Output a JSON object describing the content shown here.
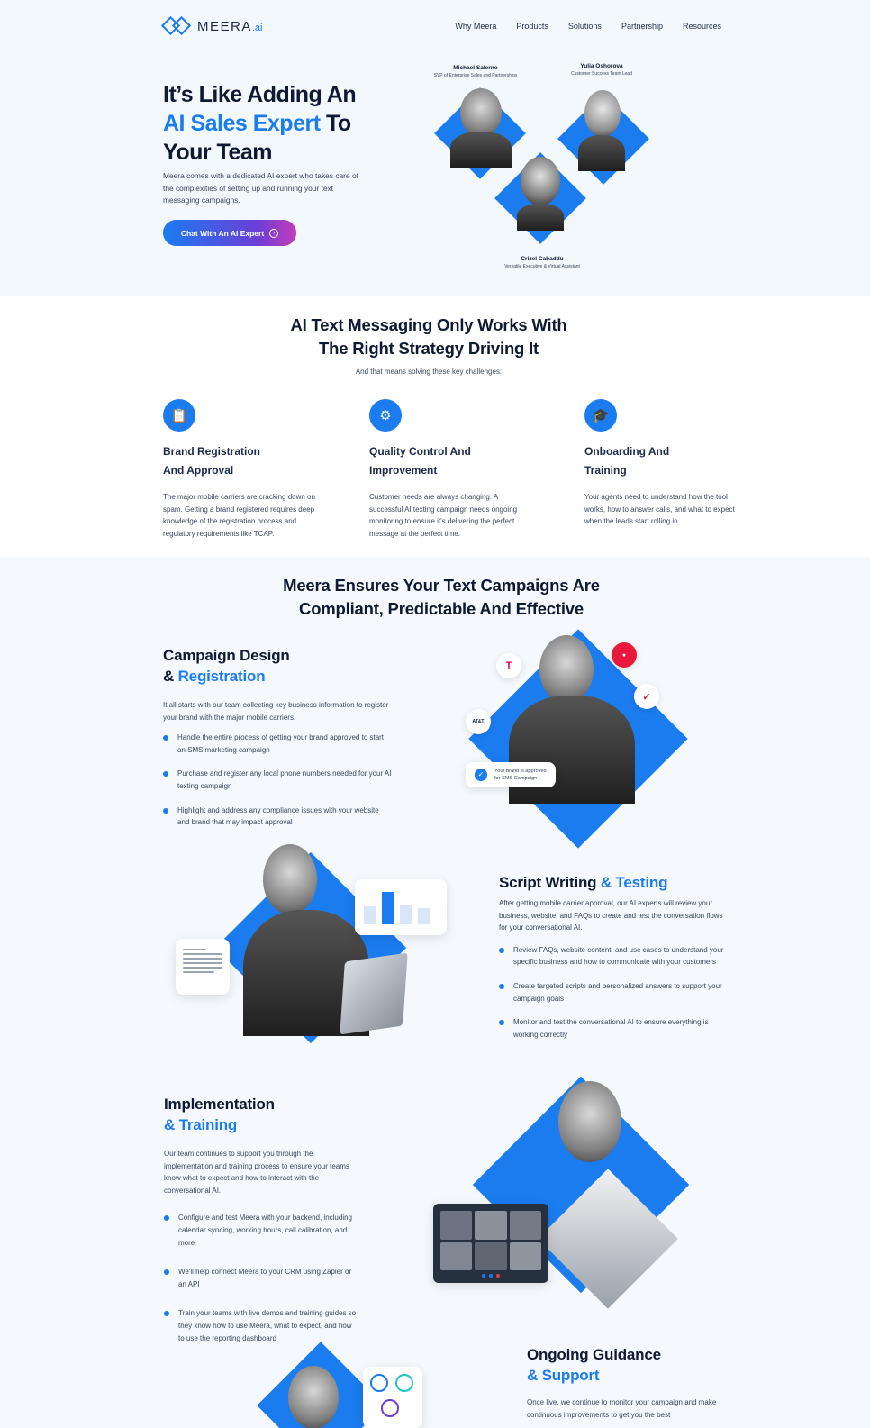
{
  "brand": {
    "name": "MEERA",
    "suffix": ".ai"
  },
  "nav": [
    "Why Meera",
    "Products",
    "Solutions",
    "Partnership",
    "Resources"
  ],
  "hero": {
    "title_l1": "It’s Like Adding An",
    "title_hl": "AI Sales Expert",
    "title_l2": " To",
    "title_l3": "Your Team",
    "description": "Meera comes with a dedicated AI expert who takes care of the complexities of setting up and running your text messaging campaigns.",
    "cta": "Chat With An AI Expert",
    "team": [
      {
        "name": "Michael Salerno",
        "role": "SVP of Enterprise Sales and Partnerships"
      },
      {
        "name": "Yulia Oshorova",
        "role": "Customer Success Team Lead"
      },
      {
        "name": "Crizel Cabaddu",
        "role": "Versatile Executive & Virtual Assistant"
      }
    ]
  },
  "strategy": {
    "title_l1": "AI Text Messaging Only Works With",
    "title_l2": "The Right Strategy Driving It",
    "subtitle": "And that means solving these key challenges:",
    "features": [
      {
        "icon": "clipboard-icon",
        "title": "Brand Registration And Approval",
        "desc": "The major mobile carriers are cracking down on spam. Getting a brand registered requires deep knowledge of the registration process and regulatory requirements like TCAP."
      },
      {
        "icon": "gear-check-icon",
        "title": "Quality Control And Improvement",
        "desc": "Customer needs are always changing. A successful AI texting campaign needs ongoing monitoring to ensure it's delivering the perfect message at the perfect time."
      },
      {
        "icon": "graduation-cap-icon",
        "title": "Onboarding And Training",
        "desc": "Your agents need to understand how the tool works, how to answer calls, and what to expect when the leads start rolling in."
      }
    ]
  },
  "ensures": {
    "title_l1": "Meera Ensures Your Text Campaigns Are",
    "title_l2": "Compliant, Predictable And Effective",
    "campaign": {
      "title_a": "Campaign Design",
      "title_b_prefix": "& ",
      "title_b": "Registration",
      "desc": "It all starts with our team collecting key business information to register your brand with the major mobile carriers.",
      "bullets": [
        "Handle the entire process of getting your brand approved to start an SMS marketing campaign",
        "Purchase and register any local phone numbers needed for your AI texting campaign",
        "Highlight and address any compliance issues with your website and brand that may impact approval"
      ],
      "approved_l1": "Your brand is approved",
      "approved_l2": "for SMS Campaign",
      "carrier_att": "AT&T"
    },
    "script": {
      "title_a": "Script Writing",
      "title_b": " & Testing",
      "desc": "After getting mobile carrier approval, our AI experts will review your business, website, and FAQs to create and test the conversation flows for your conversational AI.",
      "bullets": [
        "Review FAQs, website content, and use cases to understand your specific business and how to communicate with your customers",
        "Create targeted scripts and personalized answers to support your campaign goals",
        "Monitor and test the conversational AI to ensure everything is working correctly"
      ]
    },
    "implementation": {
      "title_a": "Implementation",
      "title_b": "& Training",
      "desc": "Our team continues to support you through the implementation and training process to ensure your teams know what to expect and how to interact with the conversational AI.",
      "bullets": [
        "Configure and test Meera with your backend, including calendar syncing, working hours, call calibration, and more",
        "We'll help connect Meera to your CRM using Zapier or an API",
        "Train your teams with live demos and training guides so they know how to use Meera, what to expect, and how to use the reporting dashboard"
      ]
    },
    "guidance": {
      "title_a": "Ongoing Guidance",
      "title_b": "& Support",
      "desc": "Once live, we continue to monitor your campaign and make continuous improvements to get you the best"
    }
  }
}
